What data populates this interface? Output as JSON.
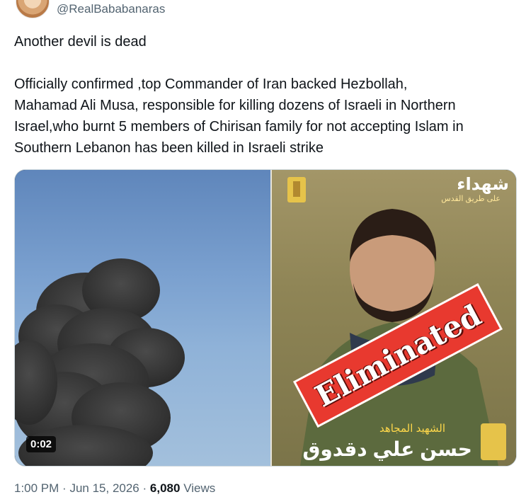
{
  "author": {
    "handle": "@RealBababanaras"
  },
  "tweet": {
    "line1": "Another devil is dead",
    "line2": "Officially confirmed ,top Commander of Iran backed Hezbollah,",
    "line3": "Mahamad Ali Musa, responsible for killing dozens of Israeli in Northern",
    "line4": "Israel,who burnt 5 members of Chirisan family for not accepting Islam in",
    "line5": "Southern Lebanon has been killed in Israeli strike"
  },
  "media": {
    "video_time": "0:02",
    "overlay_label": "Eliminated",
    "arabic_top": "شهداء",
    "arabic_top_sub": "على طريق القدس",
    "arabic_bottom1": "الشهيد المجاهد",
    "arabic_bottom2": "حسن علي دقدوق"
  },
  "meta": {
    "time": "1:00 PM",
    "sep": "·",
    "date": "Jun 15, 2026",
    "views_count": "6,080",
    "views_label": "Views"
  },
  "colors": {
    "accent_red": "#e8392f",
    "muted": "#536471"
  }
}
